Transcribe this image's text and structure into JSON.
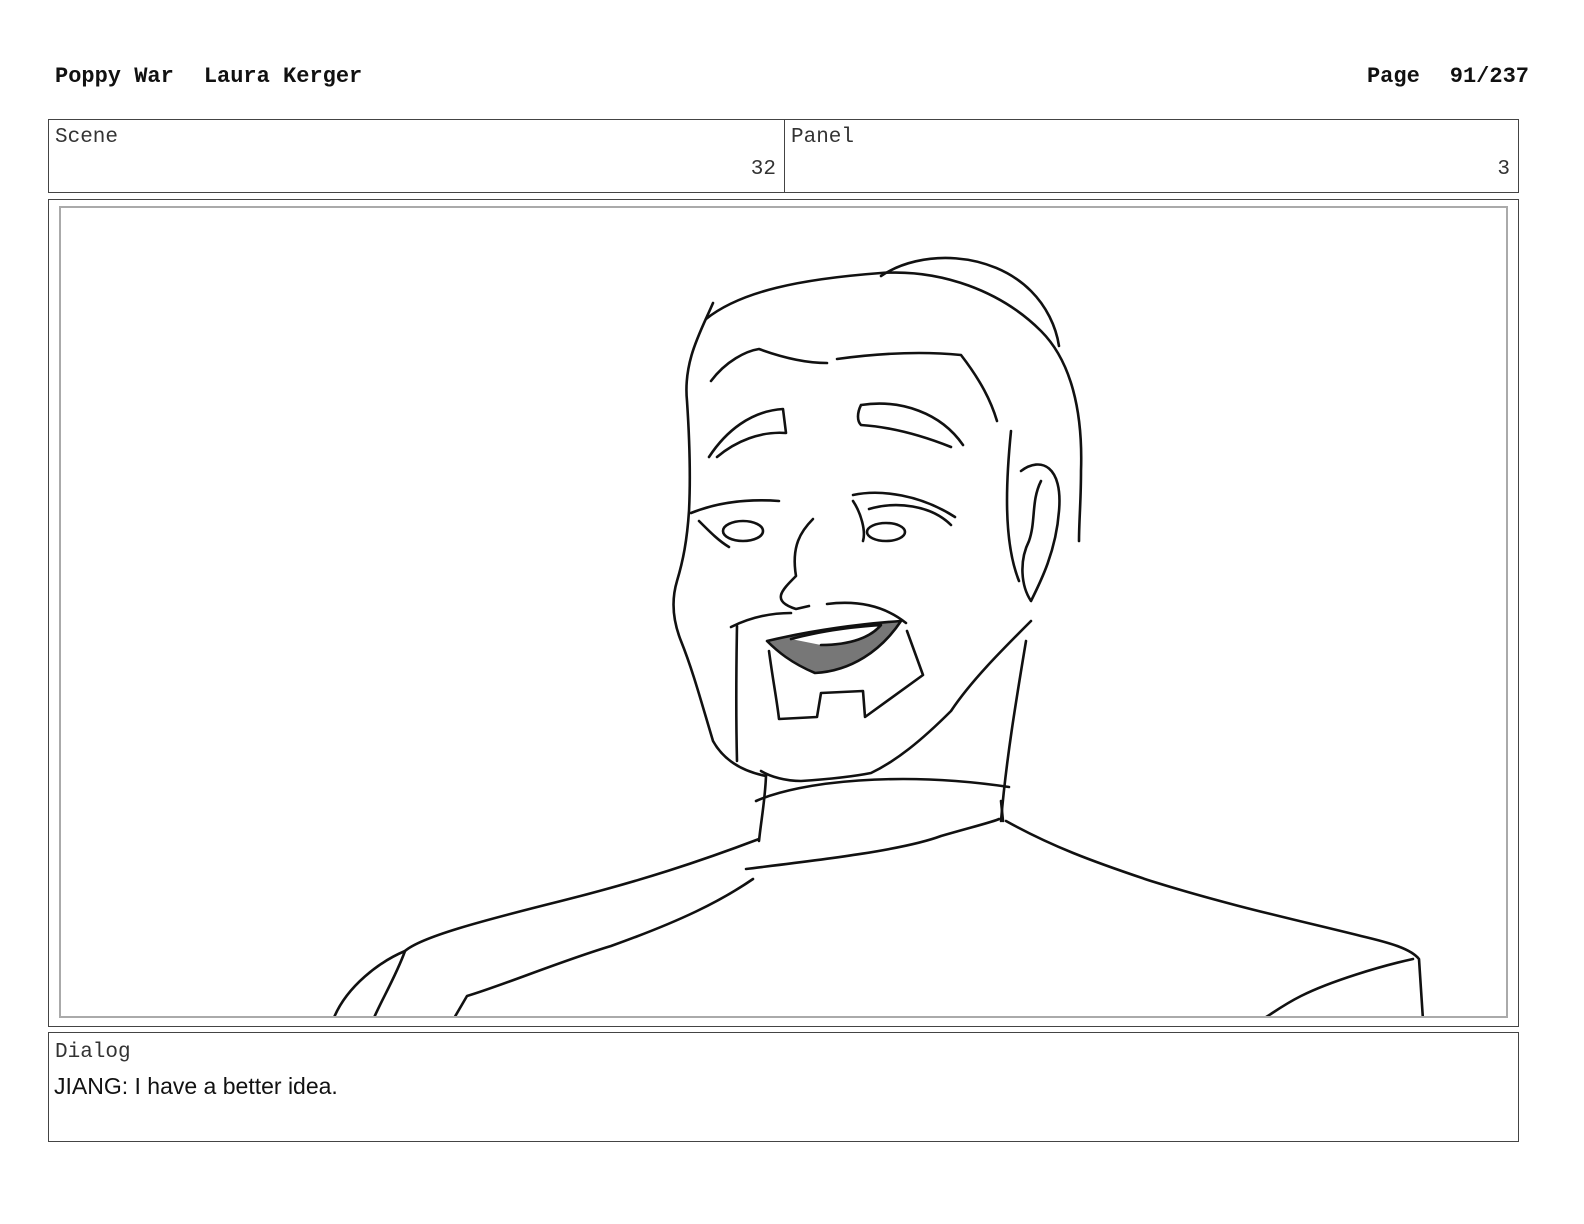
{
  "header": {
    "title": "Poppy War",
    "author": "Laura Kerger",
    "page_label": "Page",
    "page_number": "91/237"
  },
  "info": {
    "scene_label": "Scene",
    "scene_value": "32",
    "panel_label": "Panel",
    "panel_value": "3"
  },
  "dialog": {
    "label": "Dialog",
    "text": "JIANG: I have a better idea."
  }
}
